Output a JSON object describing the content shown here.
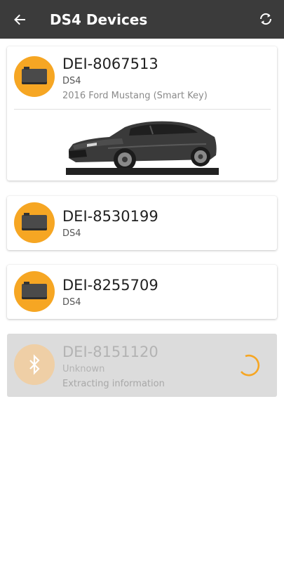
{
  "appbar": {
    "title": "DS4 Devices",
    "back_icon": "arrow-back-icon",
    "refresh_icon": "refresh-icon"
  },
  "devices": [
    {
      "name": "DEI-8067513",
      "type": "DS4",
      "vehicle": "2016 Ford Mustang (Smart Key)",
      "icon": "module-icon",
      "has_vehicle_image": true
    },
    {
      "name": "DEI-8530199",
      "type": "DS4",
      "icon": "module-icon"
    },
    {
      "name": "DEI-8255709",
      "type": "DS4",
      "icon": "module-icon"
    },
    {
      "name": "DEI-8151120",
      "type": "Unknown",
      "status": "Extracting information",
      "icon": "bluetooth-icon",
      "loading": true
    }
  ],
  "colors": {
    "appbar": "#3b3b3b",
    "accent": "#f6a623",
    "pending_card": "#dcdcdc"
  }
}
